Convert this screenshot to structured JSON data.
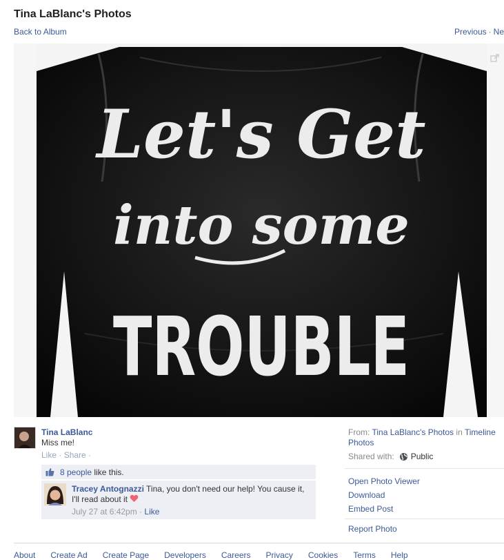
{
  "header": {
    "title": "Tina LaBlanc's Photos",
    "back_label": "Back to Album",
    "previous_label": "Previous",
    "separator": "·",
    "next_label": "Ne"
  },
  "photo": {
    "lettering": [
      "Let's Get",
      "into some",
      "TROUBLE"
    ]
  },
  "post": {
    "owner_name": "Tina LaBlanc",
    "caption": "Miss me!",
    "like_label": "Like",
    "share_label": "Share",
    "dot": "·"
  },
  "likes": {
    "count_label": "8 people",
    "suffix": "like this."
  },
  "comment": {
    "author": "Tracey Antognazzi",
    "text": "Tina, you don't need our help! You cause it, I'll read about it",
    "timestamp": "July 27 at 6:42pm",
    "dot": "·",
    "like_label": "Like"
  },
  "sidebar": {
    "from_label": "From:",
    "album_link": "Tina LaBlanc's Photos",
    "in_label": "in",
    "timeline_link": "Timeline Photos",
    "shared_label": "Shared with:",
    "audience": "Public",
    "options": [
      "Open Photo Viewer",
      "Download",
      "Embed Post"
    ],
    "report_label": "Report Photo"
  },
  "footer": {
    "links": [
      "About",
      "Create Ad",
      "Create Page",
      "Developers",
      "Careers",
      "Privacy",
      "Cookies",
      "Terms",
      "Help"
    ]
  },
  "colors": {
    "link": "#3b5998",
    "panel": "#edeff4",
    "heart": "#f0626f"
  }
}
